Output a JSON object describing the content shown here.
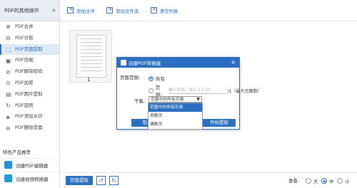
{
  "sidebar": {
    "title": "PDF的其他操作",
    "collapse_icon": "«",
    "items": [
      {
        "label": "PDF合并",
        "icon": "merge-icon",
        "active": false
      },
      {
        "label": "PDF分割",
        "icon": "split-icon",
        "active": false
      },
      {
        "label": "PDF页面提取",
        "icon": "extract-icon",
        "active": true
      },
      {
        "label": "PDF压缩",
        "icon": "compress-icon",
        "active": false
      },
      {
        "label": "PDF解除密码",
        "icon": "unlock-icon",
        "active": false
      },
      {
        "label": "PDF加密",
        "icon": "lock-icon",
        "active": false
      },
      {
        "label": "PDF图片提取",
        "icon": "image-extract-icon",
        "active": false
      },
      {
        "label": "PDF旋转",
        "icon": "rotate-icon",
        "active": false
      },
      {
        "label": "PDF添加水印",
        "icon": "watermark-icon",
        "active": false
      },
      {
        "label": "PDF删除页面",
        "icon": "delete-page-icon",
        "active": false
      }
    ],
    "section_title": "特色产品推荐",
    "products": [
      {
        "label": "迅捷PDF编辑器",
        "color": "#2a8be0"
      },
      {
        "label": "迅捷视频转换器",
        "color": "#1f9ad6"
      }
    ]
  },
  "toolbar": {
    "add_file": "添加文件",
    "add_folder": "添加文件夹",
    "clear_list": "清空列表"
  },
  "content": {
    "page_number": "1"
  },
  "bottom": {
    "extract_button": "页面提取",
    "view_label": "查看:",
    "view_options": [
      "大",
      "中",
      "小"
    ],
    "view_selected": "中"
  },
  "dialog": {
    "title": "迅捷PDF转换器",
    "close": "×",
    "range_label": "页面范围:",
    "all_label": "所有",
    "range_option_label": "范围:",
    "range_placeholder": "输入页码，如1,3,7-10",
    "range_total": "/1（最大页面数）",
    "subset_label": "子集:",
    "subset_value": "范围中的所有页面",
    "subset_options": [
      "范围中的所有页面",
      "奇数页",
      "偶数页"
    ],
    "cancel_button": "取",
    "start_button": "开始提取"
  },
  "colors": {
    "accent": "#2a6fc2"
  }
}
